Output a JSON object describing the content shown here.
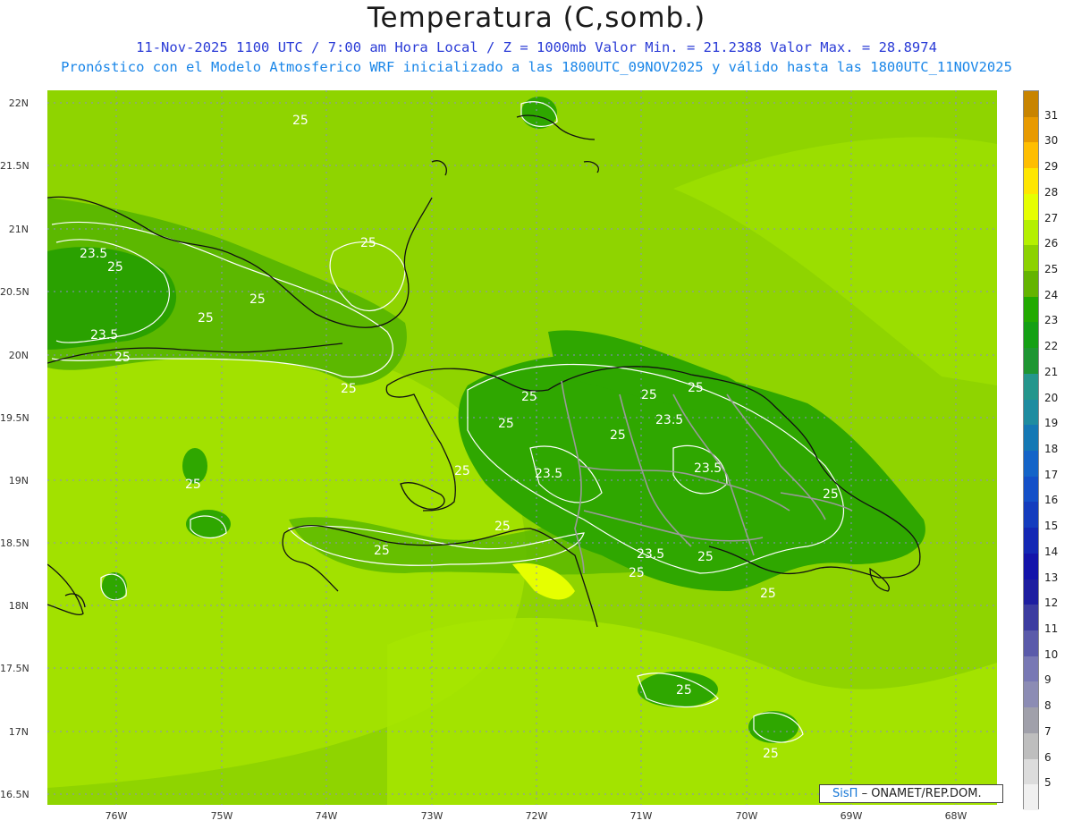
{
  "title": "Temperatura (C,somb.)",
  "subtitle_line1": "11-Nov-2025  1100 UTC / 7:00 am Hora Local / Z = 1000mb   Valor Min. = 21.2388  Valor Max. = 28.8974",
  "subtitle_line2": "Pronóstico con el Modelo Atmosferico WRF inicializado a las 1800UTC_09NOV2025 y válido hasta las  1800UTC_11NOV2025",
  "lat_labels": [
    "22N",
    "21.5N",
    "21N",
    "20.5N",
    "20N",
    "19.5N",
    "19N",
    "18.5N",
    "18N",
    "17.5N",
    "17N",
    "16.5N"
  ],
  "lon_labels": [
    "76W",
    "75W",
    "74W",
    "73W",
    "72W",
    "71W",
    "70W",
    "69W",
    "68W"
  ],
  "colorbar": {
    "labels": [
      "31",
      "30",
      "29",
      "28",
      "27",
      "26",
      "25",
      "24",
      "23",
      "22",
      "21",
      "20",
      "19",
      "18",
      "17",
      "16",
      "15",
      "14",
      "13",
      "12",
      "11",
      "10",
      "9",
      "8",
      "7",
      "6",
      "5"
    ],
    "colors": [
      "#c88400",
      "#e89a00",
      "#ffbe00",
      "#ffe600",
      "#e6ff00",
      "#b4f000",
      "#8cd200",
      "#64b400",
      "#22aa00",
      "#14a014",
      "#1e9632",
      "#24968c",
      "#1e8ca0",
      "#1478b4",
      "#1464c8",
      "#1450c8",
      "#143cbe",
      "#1428b4",
      "#1414aa",
      "#1e1ea0",
      "#3c3ca0",
      "#5a5aaa",
      "#7878b4",
      "#8c8cb4",
      "#a0a0aa",
      "#bebebe",
      "#dcdcdc",
      "#f0f0f0"
    ]
  },
  "contour_labels": {
    "minor": "23.5",
    "major": "25"
  },
  "credit": {
    "brand": "SisΠ",
    "text": "–  ONAMET/REP.DOM."
  }
}
